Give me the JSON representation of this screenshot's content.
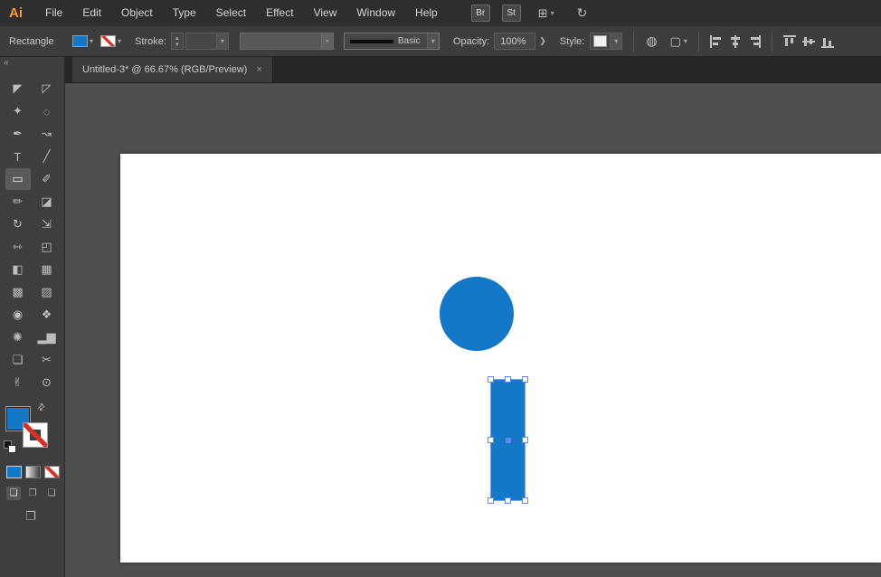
{
  "colors": {
    "shape-blue": "#1478C8",
    "selection-blue": "#7CA1F8",
    "handle-border": "#5F87F5",
    "slash-red": "#D93025",
    "logo-orange": "#FF9B3B"
  },
  "menubar": {
    "logo_text": "Ai",
    "menus": [
      {
        "name": "menu-file",
        "label": "File"
      },
      {
        "name": "menu-edit",
        "label": "Edit"
      },
      {
        "name": "menu-object",
        "label": "Object"
      },
      {
        "name": "menu-type",
        "label": "Type"
      },
      {
        "name": "menu-select",
        "label": "Select"
      },
      {
        "name": "menu-effect",
        "label": "Effect"
      },
      {
        "name": "menu-view",
        "label": "View"
      },
      {
        "name": "menu-window",
        "label": "Window"
      },
      {
        "name": "menu-help",
        "label": "Help"
      }
    ],
    "bridge_label": "Br",
    "stock_label": "St",
    "workspace_glyph": "⊞",
    "workspace_chevron": "▾",
    "sync_glyph": "↻"
  },
  "control_bar": {
    "context_label": "Rectangle",
    "fill_chevron": "▾",
    "stroke_chevron": "▾",
    "stroke_label": "Stroke:",
    "spinner_up": "▴",
    "spinner_down": "▾",
    "stroke_width_value": "",
    "stroke_width_chevron": "▾",
    "profile_chevron": "▾",
    "brush_name": "Basic",
    "brush_chevron": "▾",
    "opacity_label": "Opacity:",
    "opacity_value": "100%",
    "opacity_flyout": "❯",
    "style_label": "Style:",
    "style_chevron": "▾",
    "recolor_glyph": "◍",
    "doc_glyph": "▢",
    "doc_chevron": "▾",
    "align_h": [
      {
        "name": "horizontal-align-left-icon",
        "cls": "al-left"
      },
      {
        "name": "horizontal-align-center-icon",
        "cls": "al-hcenter"
      },
      {
        "name": "horizontal-align-right-icon",
        "cls": "al-right"
      }
    ],
    "align_v": [
      {
        "name": "vertical-align-top-icon",
        "cls": "al-top"
      },
      {
        "name": "vertical-align-center-icon",
        "cls": "al-vcenter"
      },
      {
        "name": "vertical-align-bottom-icon",
        "cls": "al-bottom"
      }
    ]
  },
  "tab": {
    "title": "Untitled-3* @ 66.67% (RGB/Preview)",
    "close_glyph": "×"
  },
  "toolbar": {
    "collapse_glyph": "«",
    "tools": [
      {
        "name": "selection-tool",
        "glyph": "◤"
      },
      {
        "name": "direct-selection-tool",
        "glyph": "◸"
      },
      {
        "name": "magic-wand-tool",
        "glyph": "✦"
      },
      {
        "name": "lasso-tool",
        "glyph": "◌"
      },
      {
        "name": "pen-tool",
        "glyph": "✒"
      },
      {
        "name": "curvature-tool",
        "glyph": "↝"
      },
      {
        "name": "type-tool",
        "glyph": "T"
      },
      {
        "name": "line-segment-tool",
        "glyph": "╱"
      },
      {
        "name": "rectangle-tool",
        "glyph": "▭",
        "selected": true
      },
      {
        "name": "paintbrush-tool",
        "glyph": "✐"
      },
      {
        "name": "shaper-tool",
        "glyph": "✏"
      },
      {
        "name": "eraser-tool",
        "glyph": "◪"
      },
      {
        "name": "rotate-tool",
        "glyph": "↻"
      },
      {
        "name": "scale-tool",
        "glyph": "⇲"
      },
      {
        "name": "width-tool",
        "glyph": "⇿"
      },
      {
        "name": "free-transform-tool",
        "glyph": "◰"
      },
      {
        "name": "shape-builder-tool",
        "glyph": "◧"
      },
      {
        "name": "perspective-grid-tool",
        "glyph": "▦"
      },
      {
        "name": "mesh-tool",
        "glyph": "▩"
      },
      {
        "name": "gradient-tool",
        "glyph": "▨"
      },
      {
        "name": "eyedropper-tool",
        "glyph": "◉"
      },
      {
        "name": "blend-tool",
        "glyph": "❖"
      },
      {
        "name": "symbol-sprayer-tool",
        "glyph": "✺"
      },
      {
        "name": "column-graph-tool",
        "glyph": "▂▆"
      },
      {
        "name": "artboard-tool",
        "glyph": "❏"
      },
      {
        "name": "slice-tool",
        "glyph": "✂"
      },
      {
        "name": "hand-tool",
        "glyph": "✌"
      },
      {
        "name": "zoom-tool",
        "glyph": "⊙"
      }
    ],
    "swap_glyph": "⇄",
    "draw_modes": [
      {
        "name": "draw-normal-button",
        "glyph": "❏",
        "selected": true
      },
      {
        "name": "draw-behind-button",
        "glyph": "❐"
      },
      {
        "name": "draw-inside-button",
        "glyph": "❑"
      }
    ],
    "screen_mode_glyph": "❒"
  }
}
